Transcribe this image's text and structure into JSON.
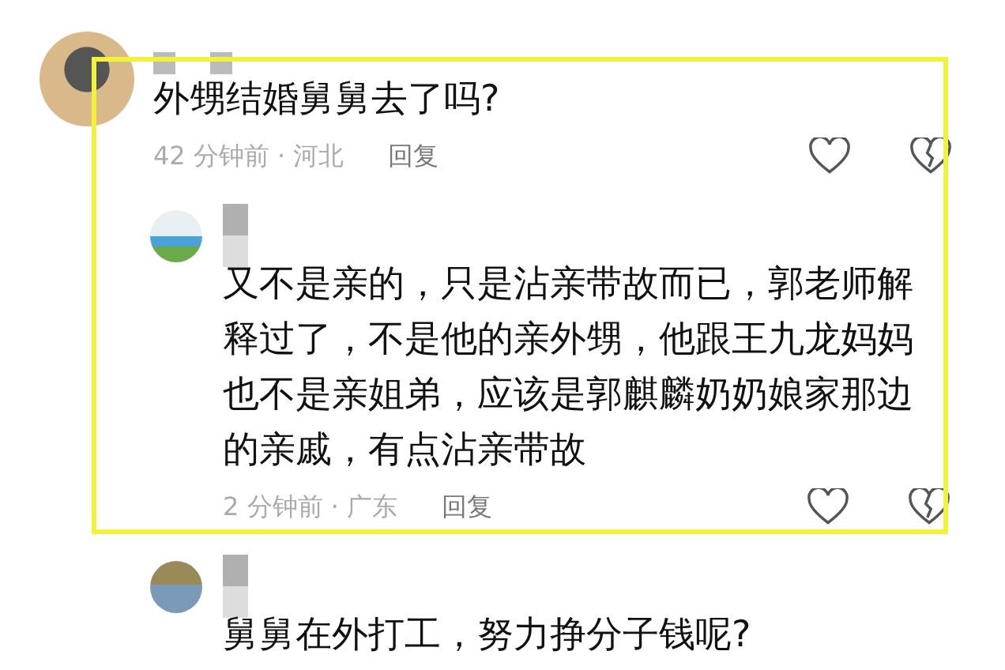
{
  "comments": [
    {
      "text": "外甥结婚舅舅去了吗?",
      "meta": "42 分钟前 · 河北",
      "reply": "回复",
      "children": [
        {
          "text": "又不是亲的，只是沾亲带故而已，郭老师解释过了，不是他的亲外甥，他跟王九龙妈妈也不是亲姐弟，应该是郭麒麟奶奶娘家那边的亲戚，有点沾亲带故",
          "meta": "2 分钟前 · 广东",
          "reply": "回复"
        },
        {
          "text": "舅舅在外打工，努力挣分子钱呢?"
        }
      ]
    }
  ]
}
